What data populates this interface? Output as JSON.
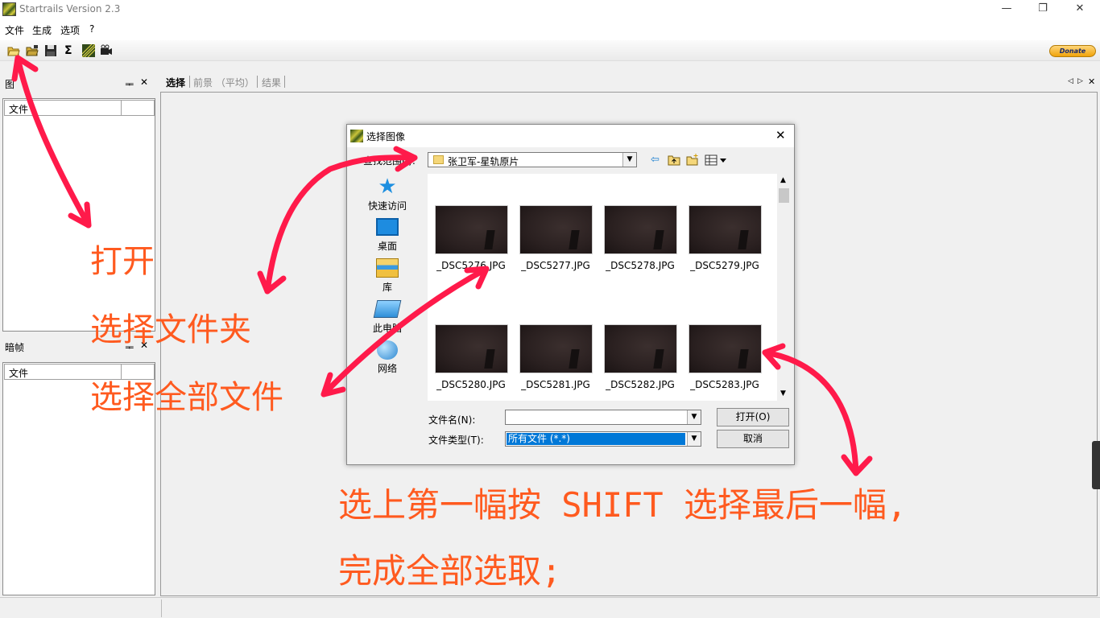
{
  "window": {
    "title": "Startrails Version 2.3",
    "minimize": "—",
    "restore": "❐",
    "close": "✕"
  },
  "menu": [
    "文件",
    "生成",
    "选项",
    "?"
  ],
  "toolbar": {
    "donate_label": "Donate"
  },
  "panels": {
    "images": {
      "title": "图",
      "column": "文件"
    },
    "darks": {
      "title": "暗帧",
      "column": "文件"
    },
    "pin": "ᆍ",
    "close": "✕"
  },
  "tabs": [
    "选择",
    "前景 （平均）",
    "结果"
  ],
  "tab_nav": {
    "prev": "◁",
    "next": "▷",
    "close": "✕"
  },
  "dialog": {
    "title": "选择图像",
    "lookin_label": "查找范围(I):",
    "folder": "张卫军-星轨原片",
    "places": [
      {
        "label": "快速访问",
        "icon": "star-icon"
      },
      {
        "label": "桌面",
        "icon": "desktop-icon"
      },
      {
        "label": "库",
        "icon": "library-icon"
      },
      {
        "label": "此电脑",
        "icon": "computer-icon"
      },
      {
        "label": "网络",
        "icon": "network-icon"
      }
    ],
    "files": [
      "_DSC5276.JPG",
      "_DSC5277.JPG",
      "_DSC5278.JPG",
      "_DSC5279.JPG",
      "_DSC5280.JPG",
      "_DSC5281.JPG",
      "_DSC5282.JPG",
      "_DSC5283.JPG"
    ],
    "filename_label": "文件名(N):",
    "filename_value": "",
    "filetype_label": "文件类型(T):",
    "filetype_value": "所有文件 (*.*)",
    "open_button": "打开(O)",
    "cancel_button": "取消",
    "close": "✕"
  },
  "annotations": {
    "open": "打开",
    "select_folder": "选择文件夹",
    "select_all": "选择全部文件",
    "instruction_line1": "选上第一幅按 SHIFT 选择最后一幅,",
    "instruction_line2": "完成全部选取;"
  },
  "colors": {
    "annotation_text": "#ff5a1f",
    "arrow": "#ff1a4a",
    "selection": "#0078d7"
  }
}
